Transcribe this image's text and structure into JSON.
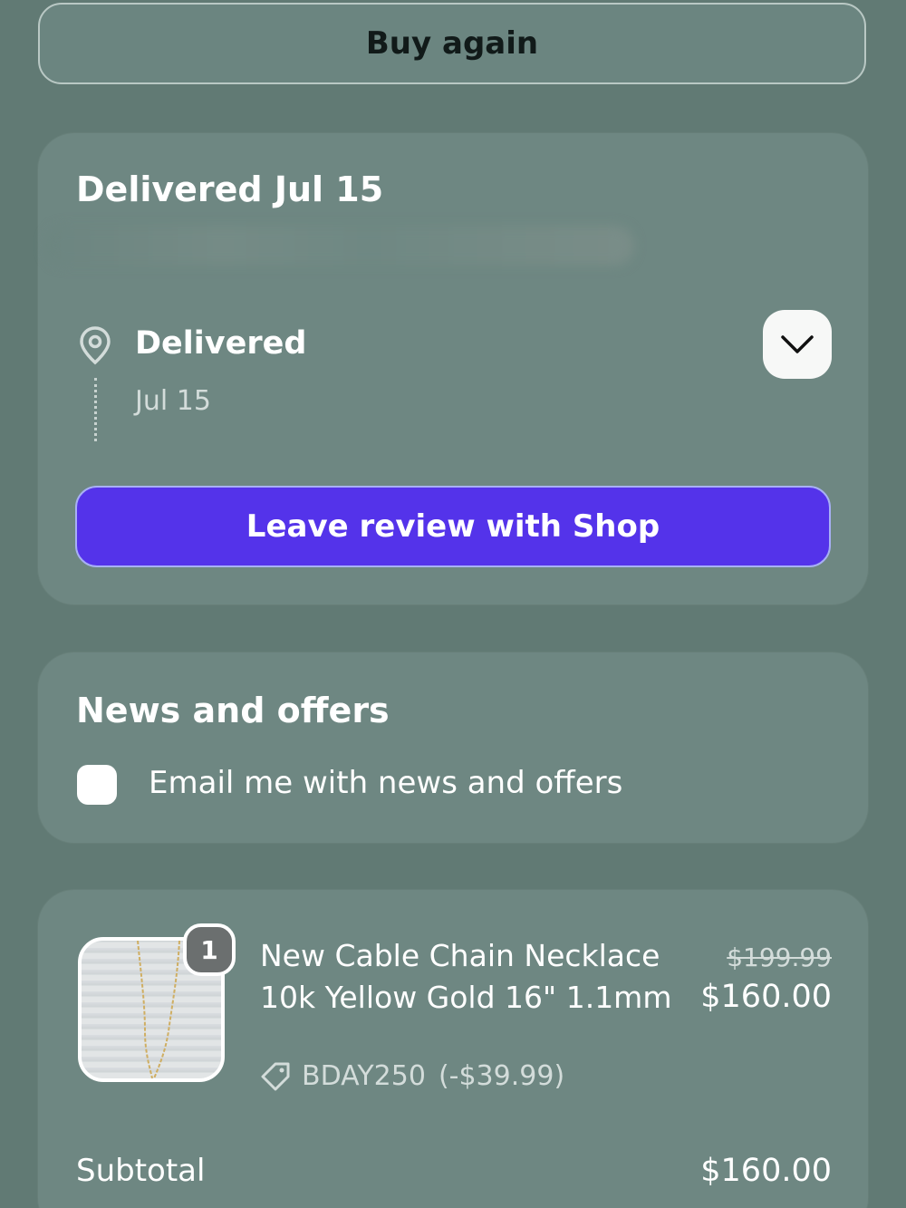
{
  "buy_again": {
    "label": "Buy again"
  },
  "delivery": {
    "title": "Delivered Jul 15",
    "status": "Delivered",
    "date": "Jul 15",
    "review_button": "Leave review with Shop"
  },
  "news": {
    "title": "News and offers",
    "checkbox_label": "Email me with news and offers",
    "checked": false
  },
  "order": {
    "item": {
      "quantity": "1",
      "name": "New Cable Chain Necklace 10k Yellow Gold 16\" 1.1mm",
      "discount_code": "BDAY250",
      "discount_amount": "(-$39.99)",
      "original_price": "$199.99",
      "price": "$160.00"
    },
    "subtotal_label": "Subtotal",
    "subtotal_value": "$160.00"
  },
  "colors": {
    "background": "#617a74",
    "card": "#6e8782",
    "accent": "#5433ea"
  },
  "icons": {
    "location": "location-pin-icon",
    "expand": "chevron-down-icon",
    "discount": "tag-icon"
  }
}
